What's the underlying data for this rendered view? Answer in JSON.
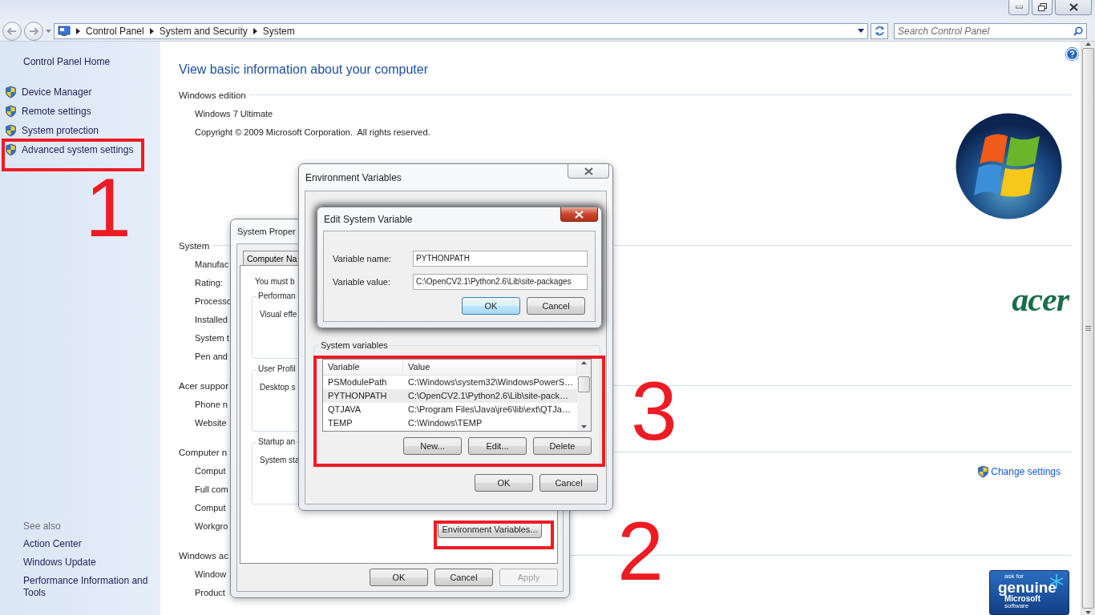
{
  "address_bar": {
    "breadcrumbs": [
      "Control Panel",
      "System and Security",
      "System"
    ]
  },
  "search": {
    "placeholder": "Search Control Panel"
  },
  "sidebar": {
    "home": "Control Panel Home",
    "tasks": [
      "Device Manager",
      "Remote settings",
      "System protection",
      "Advanced system settings"
    ],
    "see_also": {
      "title": "See also",
      "links": [
        "Action Center",
        "Windows Update",
        "Performance Information and Tools"
      ]
    }
  },
  "content": {
    "title": "View basic information about your computer",
    "sections": [
      {
        "heading": "Windows edition",
        "rows": [
          "Windows 7 Ultimate",
          "Copyright © 2009 Microsoft Corporation.  All rights reserved."
        ]
      },
      {
        "heading": "System",
        "rows": [
          "Manufac",
          "Rating:",
          "Processo",
          "Installed",
          "System t",
          "Pen and"
        ],
        "logo_text": "acer"
      },
      {
        "heading": "Acer suppor",
        "rows": [
          "Phone n",
          "Website"
        ]
      },
      {
        "heading": "Computer n",
        "rows": [
          "Comput",
          "Full com",
          "Comput",
          "Workgro"
        ],
        "link": "Change settings"
      },
      {
        "heading": "Windows ac",
        "rows": [
          "Window",
          "Product"
        ],
        "badge": [
          "ask for",
          "genuine",
          "Microsoft",
          "software"
        ]
      }
    ]
  },
  "system_properties": {
    "title": "System Proper",
    "tabs": [
      {
        "label": "Computer Na",
        "selected": false
      }
    ],
    "intro": "You must b",
    "groups": [
      {
        "label": "Performan",
        "text": "Visual effe"
      },
      {
        "label": "User Profil",
        "text": "Desktop s"
      },
      {
        "label": "Startup an",
        "text": "System sta"
      }
    ],
    "env_button": "Environment Variables...",
    "buttons": [
      {
        "label": "OK",
        "disabled": false
      },
      {
        "label": "Cancel",
        "disabled": false
      },
      {
        "label": "Apply",
        "disabled": true
      }
    ]
  },
  "environment_variables": {
    "title": "Environment Variables",
    "group_label": "System variables",
    "columns": [
      "Variable",
      "Value"
    ],
    "rows": [
      {
        "variable": "PSModulePath",
        "value": "C:\\Windows\\system32\\WindowsPowerS…",
        "selected": false
      },
      {
        "variable": "PYTHONPATH",
        "value": "C:\\OpenCV2.1\\Python2.6\\Lib\\site-pack…",
        "selected": true
      },
      {
        "variable": "QTJAVA",
        "value": "C:\\Program Files\\Java\\jre6\\lib\\ext\\QTJa…",
        "selected": false
      },
      {
        "variable": "TEMP",
        "value": "C:\\Windows\\TEMP",
        "selected": false
      }
    ],
    "actions": [
      "New...",
      "Edit...",
      "Delete"
    ],
    "buttons": [
      "OK",
      "Cancel"
    ]
  },
  "edit_variable": {
    "title": "Edit System Variable",
    "fields": [
      {
        "label": "Variable name:",
        "value": "PYTHONPATH"
      },
      {
        "label": "Variable value:",
        "value": "C:\\OpenCV2.1\\Python2.6\\Lib\\site-packages"
      }
    ],
    "buttons": [
      {
        "label": "OK",
        "default": true
      },
      {
        "label": "Cancel",
        "default": false
      }
    ]
  },
  "step_labels": [
    "1",
    "2",
    "3"
  ]
}
